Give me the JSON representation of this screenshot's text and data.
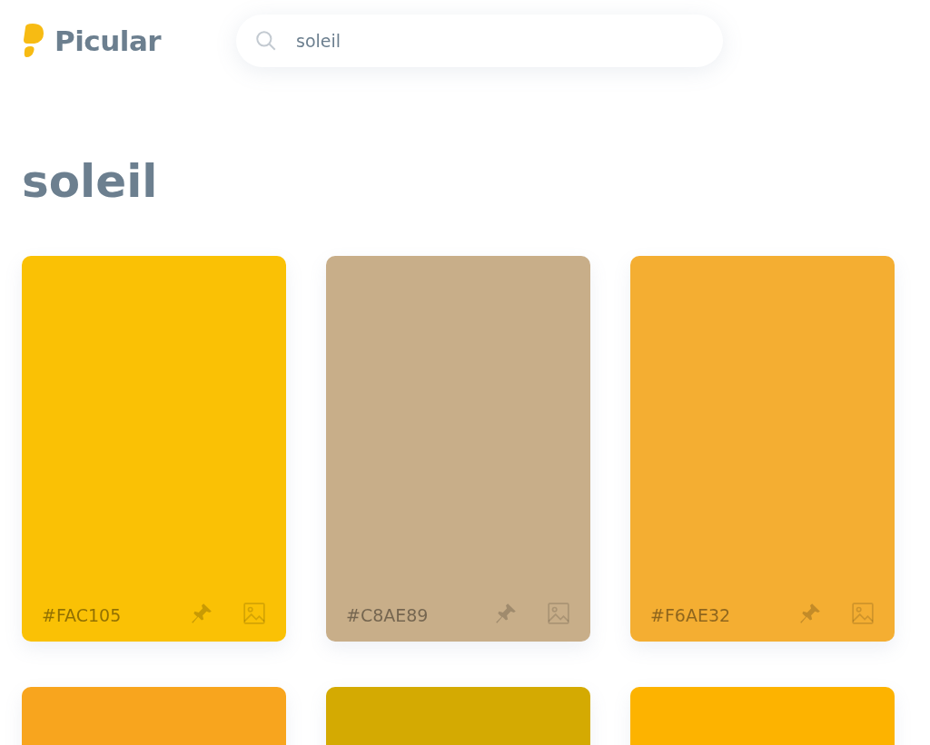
{
  "logo": {
    "name": "Picular"
  },
  "search": {
    "value": "soleil"
  },
  "heading": "soleil",
  "swatches": [
    {
      "hex": "#FAC105",
      "color": "#fac105"
    },
    {
      "hex": "#C8AE89",
      "color": "#c8ae89"
    },
    {
      "hex": "#F6AE32",
      "color": "#f4ae32"
    },
    {
      "color": "#f8a51e"
    },
    {
      "color": "#d4aa02"
    },
    {
      "color": "#fdb300"
    }
  ]
}
